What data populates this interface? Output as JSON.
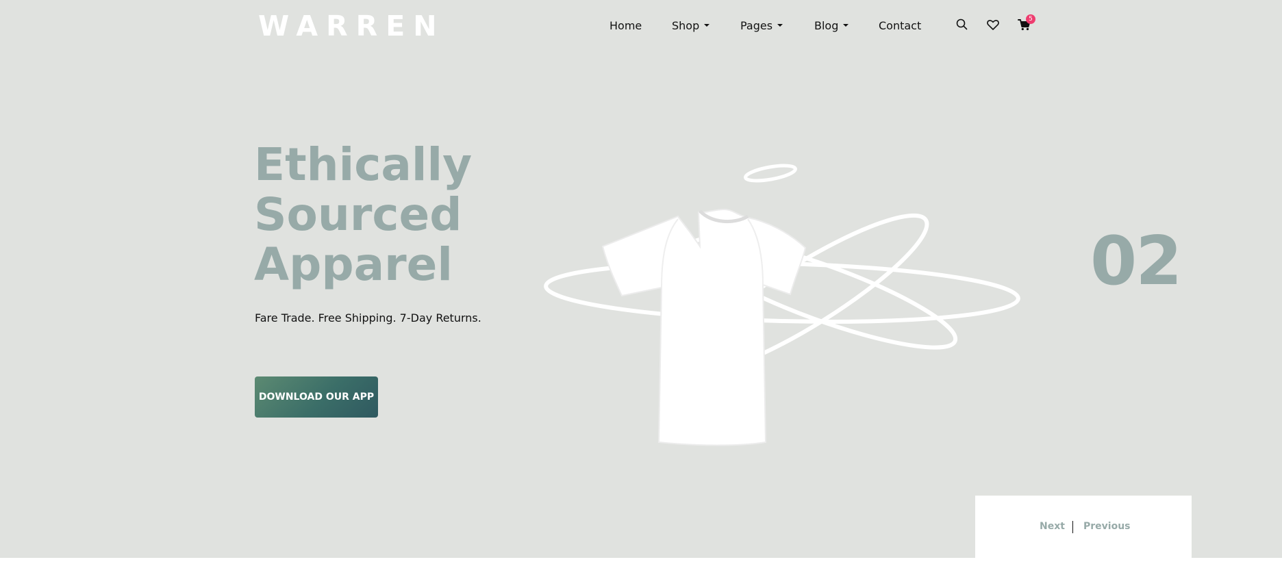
{
  "brand": {
    "logo_text": "WARREN"
  },
  "nav": {
    "home": "Home",
    "shop": "Shop",
    "pages": "Pages",
    "blog": "Blog",
    "contact": "Contact"
  },
  "header_icons": {
    "search": "search-icon",
    "wishlist": "heart-icon",
    "cart": "cart-icon",
    "cart_count": "5"
  },
  "hero": {
    "headline": [
      "Ethically",
      "Sourced",
      "Apparel"
    ],
    "tagline": "Fare Trade. Free Shipping. 7-Day Returns.",
    "cta_label": "DOWNLOAD OUR APP",
    "slide_number": "02"
  },
  "pager": {
    "next_label": "Next",
    "previous_label": "Previous"
  },
  "colors": {
    "background": "#e0e2df",
    "accent_text": "#97aaa8",
    "cta_gradient_start": "#5c8a72",
    "cta_gradient_end": "#2f5960",
    "badge": "#ee3d6f"
  }
}
